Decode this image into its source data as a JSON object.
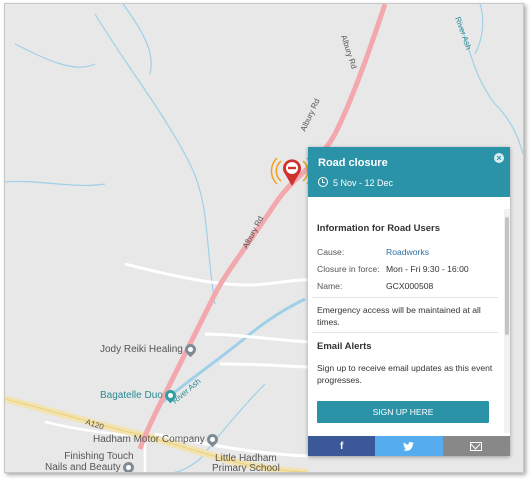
{
  "map": {
    "roads": [
      "Albury Rd",
      "Albury Rd",
      "Albury Rd",
      "A120"
    ],
    "rivers": [
      "River Ash",
      "River Ash"
    ],
    "places": [
      "Jody Reiki Healing",
      "Bagatelle Duo",
      "Hadham Motor Company",
      "Finishing Touch",
      "Nails and Beauty",
      "Little Hadham",
      "Primary School"
    ],
    "closure_marker": "no-entry-icon",
    "colors": {
      "road_closed": "#f2a8ad",
      "marker": "#d0312d",
      "marker_rings": "#f0a01e",
      "water": "#9fd0e8",
      "accent": "#2b93a8"
    }
  },
  "panel": {
    "title": "Road closure",
    "date_range": "5 Nov - 12 Dec",
    "info_heading": "Information for Road Users",
    "cause_label": "Cause:",
    "cause_value": "Roadworks",
    "closure_label": "Closure in force:",
    "closure_value": "Mon - Fri 9:30 - 16:00",
    "name_label": "Name:",
    "name_value": "GCX000508",
    "emergency_text": "Emergency access will be maintained at all times.",
    "alerts_heading": "Email Alerts",
    "alerts_text": "Sign up to receive email updates as this event progresses.",
    "signup_label": "SIGN UP HERE",
    "close_glyph": "×",
    "share": {
      "facebook": "f",
      "twitter_icon": "twitter-bird-icon",
      "email_icon": "envelope-icon"
    }
  }
}
